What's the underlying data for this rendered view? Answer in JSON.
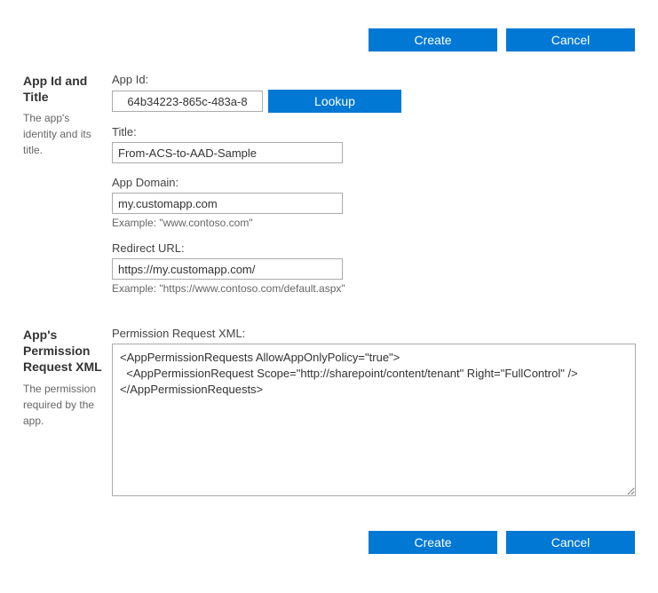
{
  "buttons": {
    "create": "Create",
    "cancel": "Cancel",
    "lookup": "Lookup"
  },
  "sections": {
    "appIdTitle": {
      "title": "App Id and Title",
      "desc": "The app's identity and its title."
    },
    "perm": {
      "title": "App's Permission Request XML",
      "desc": "The permission required by the app."
    }
  },
  "fields": {
    "appId": {
      "label": "App Id:",
      "value": "64b34223-865c-483a-8"
    },
    "title": {
      "label": "Title:",
      "value": "From-ACS-to-AAD-Sample"
    },
    "appDomain": {
      "label": "App Domain:",
      "value": "my.customapp.com",
      "hint": "Example: \"www.contoso.com\""
    },
    "redirect": {
      "label": "Redirect URL:",
      "value": "https://my.customapp.com/",
      "hint": "Example: \"https://www.contoso.com/default.aspx\""
    },
    "permXml": {
      "label": "Permission Request XML:",
      "value": "<AppPermissionRequests AllowAppOnlyPolicy=\"true\">\n  <AppPermissionRequest Scope=\"http://sharepoint/content/tenant\" Right=\"FullControl\" />\n</AppPermissionRequests>"
    }
  }
}
